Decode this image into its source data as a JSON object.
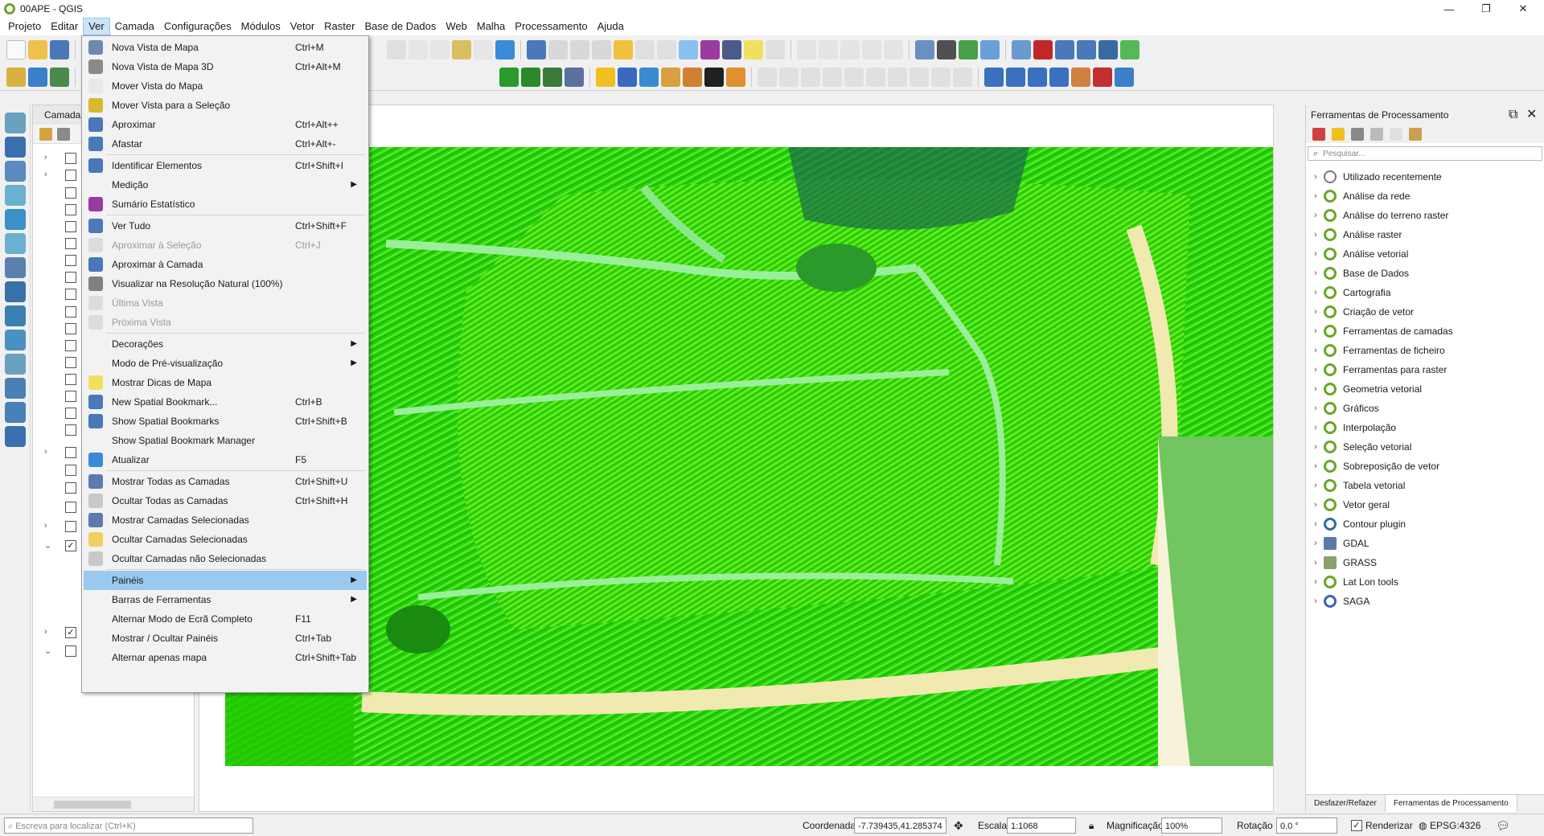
{
  "window": {
    "title": "00APE - QGIS",
    "controls": [
      "—",
      "❐",
      "✕"
    ]
  },
  "menubar": [
    "Projeto",
    "Editar",
    "Ver",
    "Camada",
    "Configurações",
    "Módulos",
    "Vetor",
    "Raster",
    "Base de Dados",
    "Web",
    "Malha",
    "Processamento",
    "Ajuda"
  ],
  "layers_panel": {
    "title": "Camadas"
  },
  "view_menu": [
    {
      "label": "Nova Vista de Mapa",
      "shortcut": "Ctrl+M",
      "icon": "new-map-view-icon"
    },
    {
      "label": "Nova Vista de Mapa 3D",
      "shortcut": "Ctrl+Alt+M",
      "icon": "new-3d-map-view-icon"
    },
    {
      "label": "Mover Vista do Mapa",
      "shortcut": "",
      "icon": "pan-hand-icon"
    },
    {
      "label": "Mover Vista para a Seleção",
      "shortcut": "",
      "icon": "pan-to-selection-icon"
    },
    {
      "label": "Aproximar",
      "shortcut": "Ctrl+Alt++",
      "icon": "zoom-in-icon"
    },
    {
      "label": "Afastar",
      "shortcut": "Ctrl+Alt+-",
      "icon": "zoom-out-icon"
    },
    {
      "sep": true
    },
    {
      "label": "Identificar Elementos",
      "shortcut": "Ctrl+Shift+I",
      "icon": "identify-icon"
    },
    {
      "label": "Medição",
      "shortcut": "",
      "submenu": true,
      "icon": ""
    },
    {
      "label": "Sumário Estatístico",
      "shortcut": "",
      "icon": "sigma-icon"
    },
    {
      "sep": true
    },
    {
      "label": "Ver Tudo",
      "shortcut": "Ctrl+Shift+F",
      "icon": "zoom-full-icon"
    },
    {
      "label": "Aproximar à Seleção",
      "shortcut": "Ctrl+J",
      "disabled": true,
      "icon": "zoom-to-selection-icon"
    },
    {
      "label": "Aproximar à Camada",
      "shortcut": "",
      "icon": "zoom-to-layer-icon"
    },
    {
      "label": "Visualizar na Resolução Natural (100%)",
      "shortcut": "",
      "icon": "zoom-actual-icon"
    },
    {
      "label": "Última Vista",
      "shortcut": "",
      "disabled": true,
      "icon": "zoom-last-icon"
    },
    {
      "label": "Próxima Vista",
      "shortcut": "",
      "disabled": true,
      "icon": "zoom-next-icon"
    },
    {
      "sep": true
    },
    {
      "label": "Decorações",
      "shortcut": "",
      "submenu": true,
      "icon": ""
    },
    {
      "label": "Modo de Pré-visualização",
      "shortcut": "",
      "submenu": true,
      "icon": ""
    },
    {
      "label": "Mostrar Dicas de Mapa",
      "shortcut": "",
      "icon": "map-tips-icon"
    },
    {
      "label": "New Spatial Bookmark...",
      "shortcut": "Ctrl+B",
      "icon": "new-bookmark-icon"
    },
    {
      "label": "Show Spatial Bookmarks",
      "shortcut": "Ctrl+Shift+B",
      "icon": "show-bookmarks-icon"
    },
    {
      "label": "Show Spatial Bookmark Manager",
      "shortcut": "",
      "icon": ""
    },
    {
      "label": "Atualizar",
      "shortcut": "F5",
      "icon": "refresh-icon"
    },
    {
      "sep": true
    },
    {
      "label": "Mostrar Todas as Camadas",
      "shortcut": "Ctrl+Shift+U",
      "icon": "show-all-layers-icon"
    },
    {
      "label": "Ocultar Todas as Camadas",
      "shortcut": "Ctrl+Shift+H",
      "icon": "hide-all-layers-icon"
    },
    {
      "label": "Mostrar Camadas Selecionadas",
      "shortcut": "",
      "icon": "show-selected-layers-icon"
    },
    {
      "label": "Ocultar Camadas Selecionadas",
      "shortcut": "",
      "icon": "hide-selected-layers-icon"
    },
    {
      "label": "Ocultar Camadas não Selecionadas",
      "shortcut": "",
      "icon": "hide-deselected-layers-icon"
    },
    {
      "sep": true
    },
    {
      "label": "Painéis",
      "shortcut": "",
      "submenu": true,
      "highlight": true,
      "icon": ""
    },
    {
      "label": "Barras de Ferramentas",
      "shortcut": "",
      "submenu": true,
      "icon": ""
    },
    {
      "label": "Alternar Modo de Ecrã Completo",
      "shortcut": "F11",
      "icon": ""
    },
    {
      "label": "Mostrar / Ocultar Painéis",
      "shortcut": "Ctrl+Tab",
      "icon": ""
    },
    {
      "label": "Alternar apenas mapa",
      "shortcut": "Ctrl+Shift+Tab",
      "icon": ""
    }
  ],
  "toolbox": {
    "title": "Ferramentas de Processamento",
    "search_placeholder": "Pesquisar...",
    "items": [
      {
        "label": "Utilizado recentemente",
        "icon": "clock"
      },
      {
        "label": "Análise da rede",
        "icon": "q"
      },
      {
        "label": "Análise do terreno raster",
        "icon": "q"
      },
      {
        "label": "Análise raster",
        "icon": "q"
      },
      {
        "label": "Análise vetorial",
        "icon": "q"
      },
      {
        "label": "Base de Dados",
        "icon": "q"
      },
      {
        "label": "Cartografia",
        "icon": "q"
      },
      {
        "label": "Criação de vetor",
        "icon": "q"
      },
      {
        "label": "Ferramentas de camadas",
        "icon": "q"
      },
      {
        "label": "Ferramentas de ficheiro",
        "icon": "q"
      },
      {
        "label": "Ferramentas para raster",
        "icon": "q"
      },
      {
        "label": "Geometria vetorial",
        "icon": "q"
      },
      {
        "label": "Gráficos",
        "icon": "q"
      },
      {
        "label": "Interpolação",
        "icon": "q"
      },
      {
        "label": "Seleção vetorial",
        "icon": "q"
      },
      {
        "label": "Sobreposição de vetor",
        "icon": "q"
      },
      {
        "label": "Tabela vetorial",
        "icon": "q"
      },
      {
        "label": "Vetor geral",
        "icon": "q"
      },
      {
        "label": "Contour plugin",
        "icon": "contour"
      },
      {
        "label": "GDAL",
        "icon": "gdal"
      },
      {
        "label": "GRASS",
        "icon": "grass"
      },
      {
        "label": "Lat Lon tools",
        "icon": "q"
      },
      {
        "label": "SAGA",
        "icon": "saga"
      }
    ],
    "tabs": [
      "Desfazer/Refazer",
      "Ferramentas de Processamento"
    ]
  },
  "statusbar": {
    "locator_placeholder": "Escreva para localizar (Ctrl+K)",
    "coord_label": "Coordenada",
    "coord_value": "-7.739435,41.285374",
    "scale_label": "Escala",
    "scale_value": "1:1068",
    "magnification_label": "Magnificação",
    "magnification_value": "100%",
    "rotation_label": "Rotação",
    "rotation_value": "0.0 °",
    "render_label": "Renderizar",
    "crs_label": "EPSG:4326"
  },
  "colors": {
    "menu_highlight": "#99c9ef",
    "qgis_green": "#6aa625",
    "raster_bright": "#22e000",
    "raster_sand": "#ece6a0"
  }
}
